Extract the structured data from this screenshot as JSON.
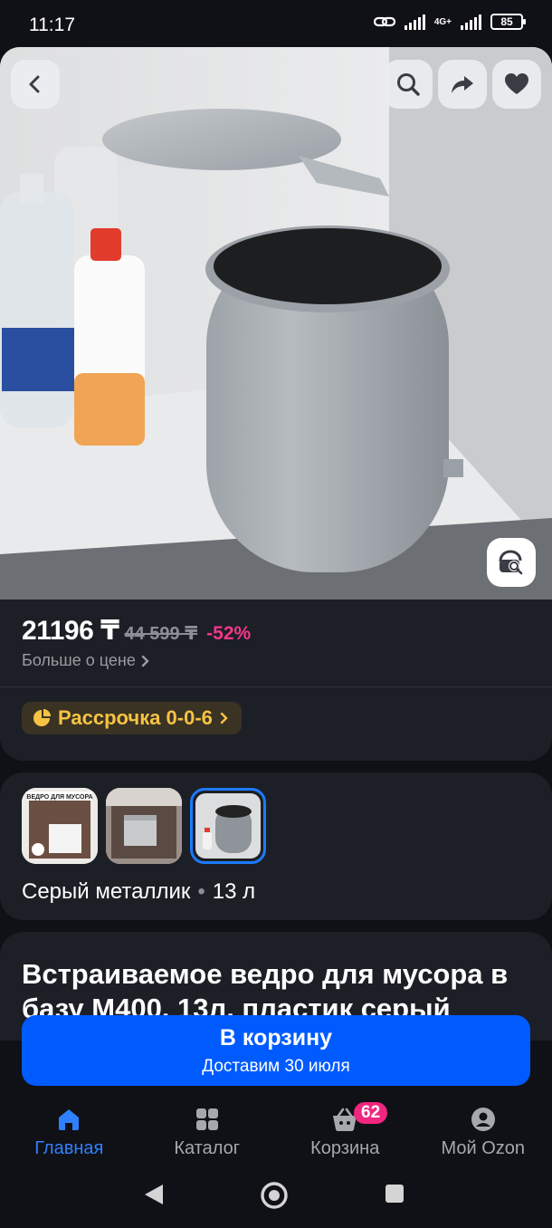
{
  "status_bar": {
    "time": "11:17",
    "network": "4G+",
    "battery": "85"
  },
  "product": {
    "price_current": "21196 ₸",
    "price_old": "44 599 ₸",
    "discount": "-52%",
    "price_more_link": "Больше о цене",
    "installment_label": "Рассрочка 0-0-6",
    "variant_color": "Серый металлик",
    "variant_separator": "•",
    "variant_volume": "13 л",
    "title": "Встраиваемое ведро для мусора в базу М400, 13л, пластик серый",
    "thumbnails": [
      {
        "name": "variant-1",
        "caption": "ВЕДРО ДЛЯ МУСОРА"
      },
      {
        "name": "variant-2"
      },
      {
        "name": "variant-3",
        "selected": true
      }
    ]
  },
  "cart_button": {
    "label": "В корзину",
    "sublabel": "Доставим 30 июля"
  },
  "bottom_nav": {
    "items": [
      {
        "label": "Главная",
        "icon": "home-icon",
        "active": true
      },
      {
        "label": "Каталог",
        "icon": "catalog-icon"
      },
      {
        "label": "Корзина",
        "icon": "basket-icon",
        "badge": "62"
      },
      {
        "label": "Мой Ozon",
        "icon": "profile-icon"
      }
    ]
  },
  "colors": {
    "accent": "#005bff",
    "discount": "#f2378a",
    "installment": "#f6c343",
    "badge": "#f1267e",
    "card": "#1d1f26",
    "background": "#101116"
  }
}
